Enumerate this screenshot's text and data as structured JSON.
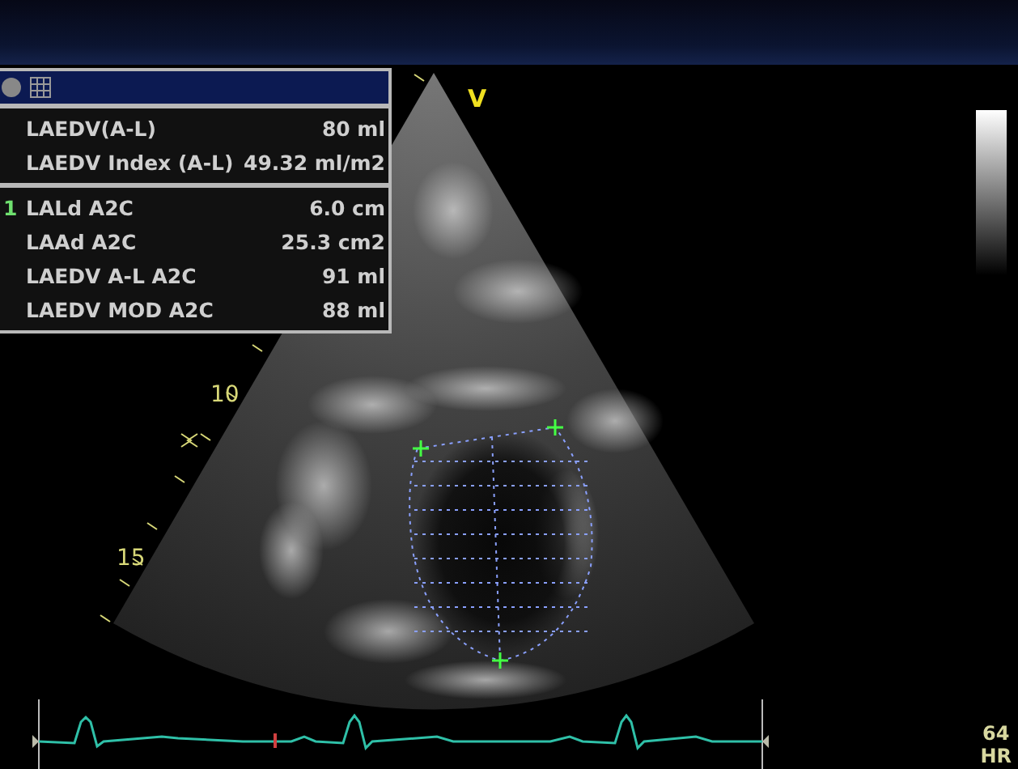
{
  "measurements": {
    "groups": [
      [
        {
          "label": "LAEDV(A-L)",
          "value": "80 ml"
        },
        {
          "label": "LAEDV Index (A-L)",
          "value": "49.32 ml/m2"
        }
      ],
      [
        {
          "label": "LALd A2C",
          "value": "6.0 cm",
          "marker": "1"
        },
        {
          "label": "LAAd A2C",
          "value": "25.3 cm2"
        },
        {
          "label": "LAEDV A-L A2C",
          "value": "91 ml"
        },
        {
          "label": "LAEDV MOD A2C",
          "value": "88 ml"
        }
      ]
    ]
  },
  "orientation_mark": "V",
  "depth_labels": [
    "10",
    "15"
  ],
  "heart_rate": {
    "value": "64",
    "label": "HR"
  }
}
